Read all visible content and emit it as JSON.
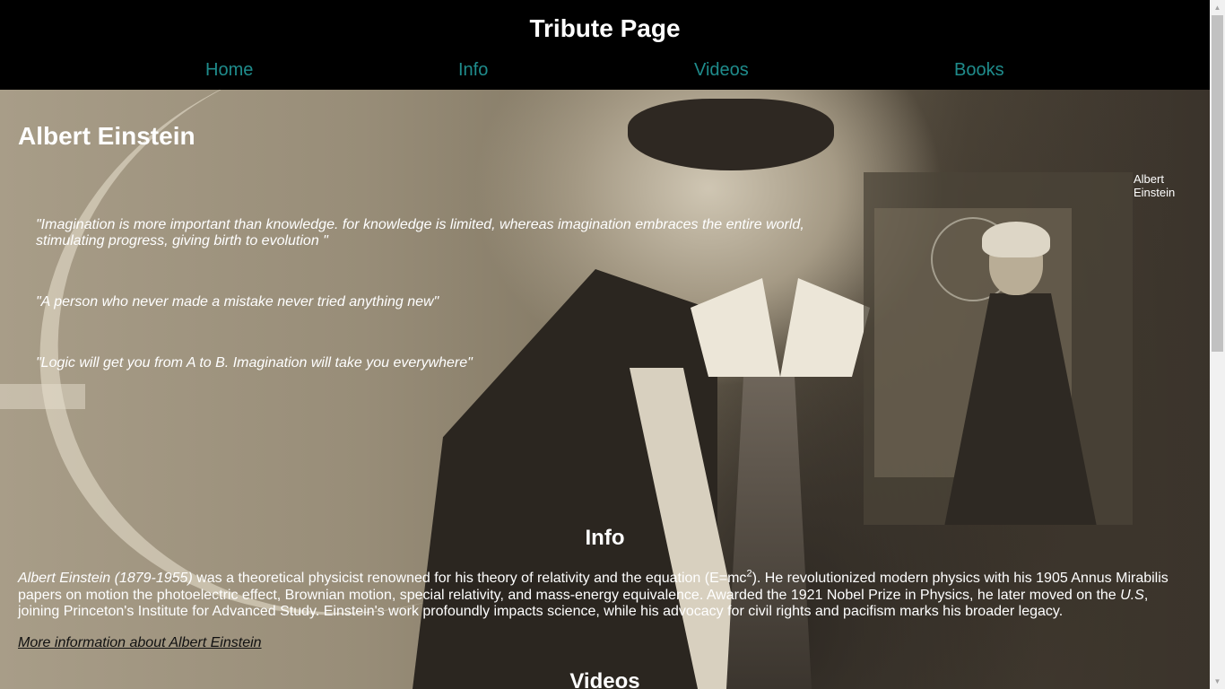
{
  "header": {
    "title": "Tribute Page",
    "nav": [
      "Home",
      "Info",
      "Videos",
      "Books"
    ]
  },
  "main": {
    "name": "Albert Einstein",
    "quotes": [
      "\"Imagination is more important than knowledge. for knowledge is limited, whereas imagination embraces the entire world, stimulating progress, giving birth to evolution \"",
      "\"A person who never made a mistake never tried anything new\"",
      "\"Logic will get you from A to B. Imagination will take you everywhere\""
    ],
    "image_caption": "Albert Einstein"
  },
  "info": {
    "heading": "Info",
    "name_dates": "Albert Einstein (1879-1955)",
    "text_1": " was a theoretical physicist renowned for his theory of relativity and the equation (E=mc",
    "superscript": "2",
    "text_2": "). He revolutionized modern physics with his 1905 Annus Mirabilis papers on motion the photoelectric effect, Brownian motion, special relativity, and mass-energy equivalence. Awarded the 1921 Nobel Prize in Physics, he later moved on the ",
    "country": "U.S",
    "text_3": ", joining Princeton's Institute for Advanced Study. Einstein's work profoundly impacts science, while his advocacy for civil rights and pacifism marks his broader legacy.",
    "more_link": "More information about Albert Einstein"
  },
  "videos": {
    "heading": "Videos"
  },
  "colors": {
    "header_bg": "#000000",
    "nav_link": "#1f8c8c",
    "text": "#ffffff"
  }
}
